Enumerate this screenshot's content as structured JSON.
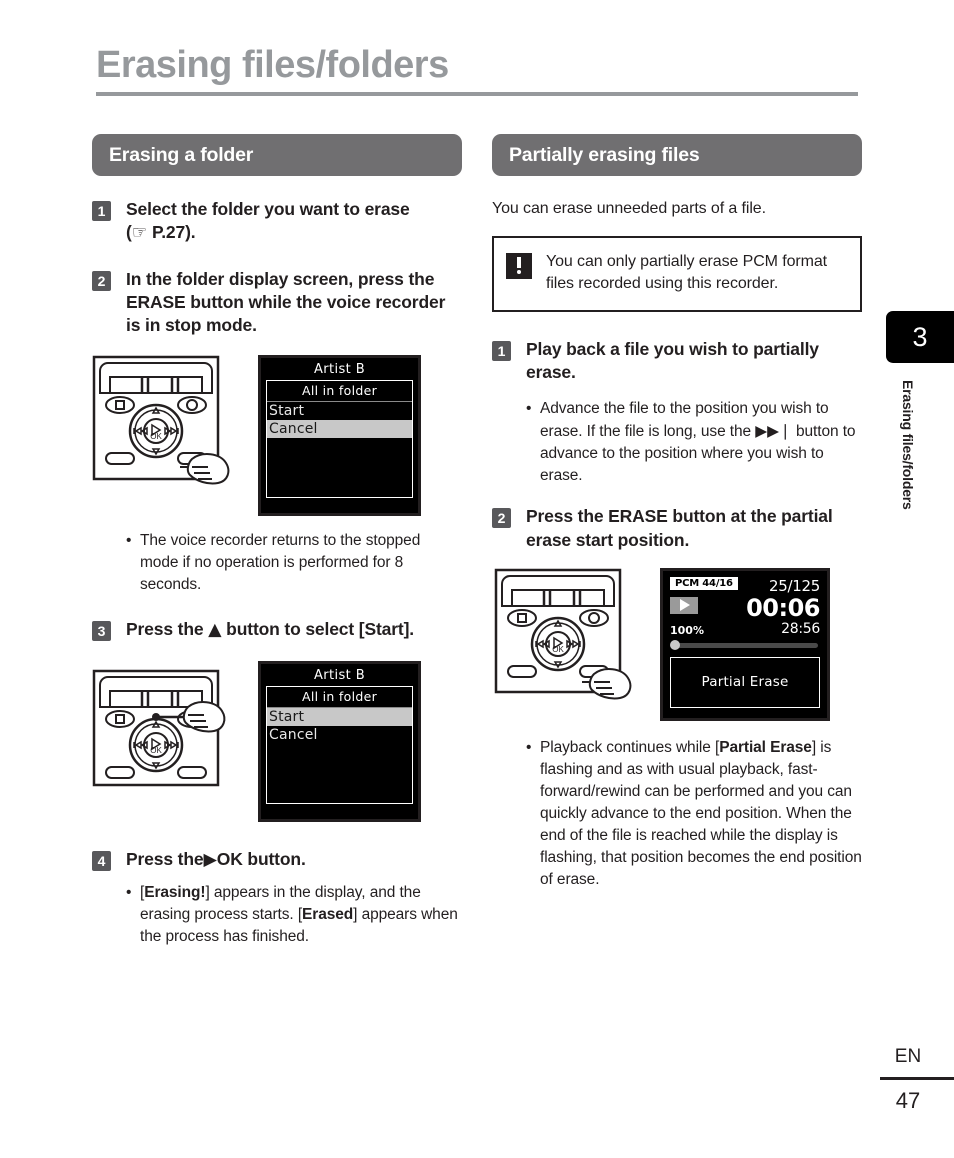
{
  "page": {
    "title": "Erasing files/folders",
    "chapter_number": "3",
    "chapter_label": "Erasing files/folders",
    "language_code": "EN",
    "page_number": "47",
    "title_color": "#96999c",
    "section_bar_color": "#706f71",
    "step_badge_color": "#58585b"
  },
  "left_column": {
    "section_title": "Erasing a folder",
    "steps": [
      {
        "number": "1",
        "text": "Select the folder you want to erase (☞ P.27)."
      },
      {
        "number": "2",
        "text": "In the folder display screen, press the ERASE button while the voice recorder is in stop mode."
      },
      {
        "number": "3",
        "text": "Press the ▲ button to select [Start]."
      },
      {
        "number": "4",
        "text": "Press the ▶OK button."
      }
    ],
    "bullet_after_step2": "The voice recorder returns to the stopped mode if no operation is performed for 8 seconds.",
    "bullet_after_step4": "[Erasing!] appears in the display, and the erasing process starts. [Erased] appears when the process has finished.",
    "lcd_step2": {
      "title": "Artist B",
      "panel_heading": "All in folder",
      "items": [
        "Start",
        "Cancel"
      ],
      "selected": "Cancel"
    },
    "lcd_step3": {
      "title": "Artist B",
      "panel_heading": "All in folder",
      "items": [
        "Start",
        "Cancel"
      ],
      "selected": "Start"
    }
  },
  "right_column": {
    "section_title": "Partially erasing files",
    "intro": "You can erase unneeded parts of a file.",
    "note": {
      "icon": "exclamation-icon",
      "text": "You can only partially erase PCM format files recorded using this recorder."
    },
    "steps": [
      {
        "number": "1",
        "text": "Play back a file you wish to partially erase."
      },
      {
        "number": "2",
        "text": "Press the ERASE button at the partial erase start position."
      }
    ],
    "bullet_after_step1": "Advance the file to the position you wish to erase. If the file is long, use the ▶▶❘ button to advance to the position where you wish to erase.",
    "bullet_after_step2": "Playback continues while [Partial Erase] is flashing and as with usual playback, fast-forward/rewind can be performed and you can quickly advance to the end position. When the end of the file is reached while the display is flashing, that position becomes the end position of erase.",
    "lcd_playback": {
      "format_badge": "PCM 44/16",
      "track_count": "25/125",
      "play_state_icon": "play-icon",
      "speed": "100%",
      "current_time": "00:06",
      "total_time": "28:56",
      "progress_percent": 3,
      "message": "Partial Erase"
    }
  }
}
